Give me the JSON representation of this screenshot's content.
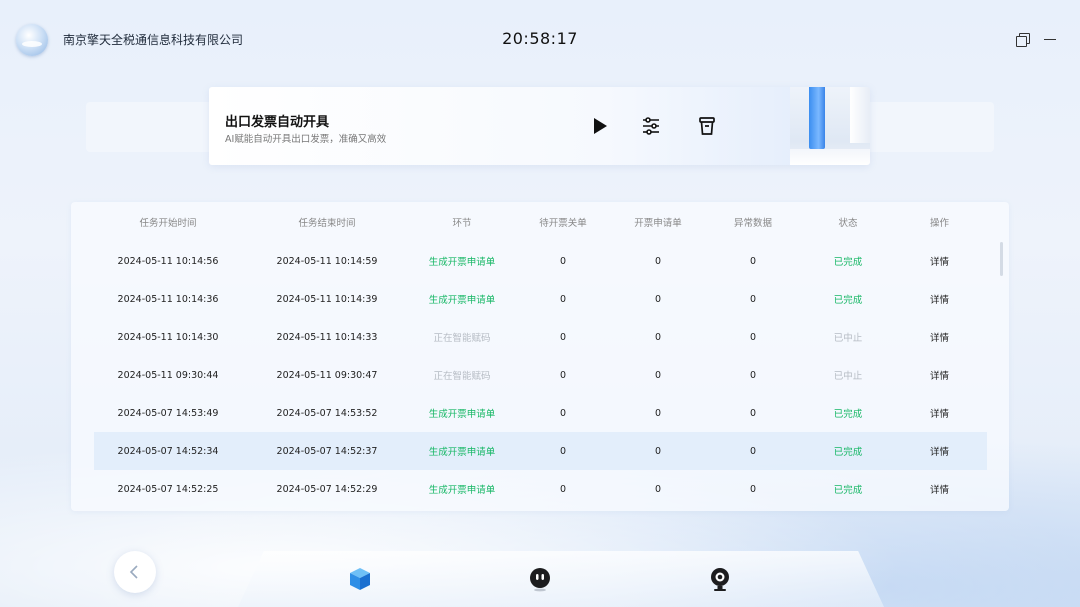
{
  "header": {
    "company": "南京擎天全税通信息科技有限公司",
    "time": "20:58:17"
  },
  "banner": {
    "title": "出口发票自动开具",
    "subtitle": "AI赋能自动开具出口发票，准确又高效"
  },
  "table": {
    "columns": [
      "任务开始时间",
      "任务结束时间",
      "环节",
      "待开票关单",
      "开票申请单",
      "异常数据",
      "状态",
      "操作"
    ],
    "rows": [
      {
        "start": "2024-05-11 10:14:56",
        "end": "2024-05-11 10:14:59",
        "stage": "生成开票申请单",
        "pending": "0",
        "applications": "0",
        "abnormal": "0",
        "status": "已完成",
        "action": "详情",
        "state": "done"
      },
      {
        "start": "2024-05-11 10:14:36",
        "end": "2024-05-11 10:14:39",
        "stage": "生成开票申请单",
        "pending": "0",
        "applications": "0",
        "abnormal": "0",
        "status": "已完成",
        "action": "详情",
        "state": "done"
      },
      {
        "start": "2024-05-11 10:14:30",
        "end": "2024-05-11 10:14:33",
        "stage": "正在智能赋码",
        "pending": "0",
        "applications": "0",
        "abnormal": "0",
        "status": "已中止",
        "action": "详情",
        "state": "stopped"
      },
      {
        "start": "2024-05-11 09:30:44",
        "end": "2024-05-11 09:30:47",
        "stage": "正在智能赋码",
        "pending": "0",
        "applications": "0",
        "abnormal": "0",
        "status": "已中止",
        "action": "详情",
        "state": "stopped"
      },
      {
        "start": "2024-05-07 14:53:49",
        "end": "2024-05-07 14:53:52",
        "stage": "生成开票申请单",
        "pending": "0",
        "applications": "0",
        "abnormal": "0",
        "status": "已完成",
        "action": "详情",
        "state": "done"
      },
      {
        "start": "2024-05-07 14:52:34",
        "end": "2024-05-07 14:52:37",
        "stage": "生成开票申请单",
        "pending": "0",
        "applications": "0",
        "abnormal": "0",
        "status": "已完成",
        "action": "详情",
        "state": "done",
        "highlighted": true
      },
      {
        "start": "2024-05-07 14:52:25",
        "end": "2024-05-07 14:52:29",
        "stage": "生成开票申请单",
        "pending": "0",
        "applications": "0",
        "abnormal": "0",
        "status": "已完成",
        "action": "详情",
        "state": "done"
      }
    ]
  },
  "icons": {
    "header": [
      "restore-window-icon",
      "minimize-window-icon"
    ],
    "toolbar": [
      "play-icon",
      "sliders-icon",
      "trash-icon"
    ],
    "dock": [
      "chevron-left-icon",
      "cube-icon",
      "robot-icon",
      "camera-icon"
    ]
  },
  "colors": {
    "status_done": "#16b765",
    "status_stopped": "#b6bcc4",
    "accent_blue": "#2f7fe8"
  }
}
